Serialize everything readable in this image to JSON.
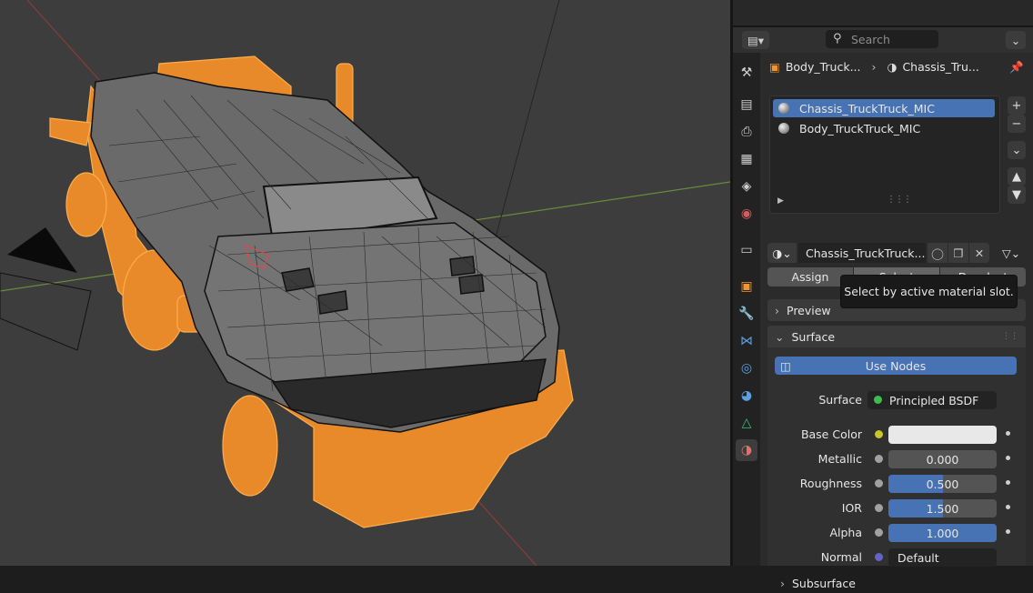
{
  "header": {
    "search_placeholder": "Search"
  },
  "breadcrumb": {
    "object": "Body_Truck...",
    "material": "Chassis_Tru..."
  },
  "material_slots": [
    {
      "label": "Chassis_TruckTruck_MIC",
      "selected": true
    },
    {
      "label": "Body_TruckTruck_MIC",
      "selected": false
    }
  ],
  "material_selector": {
    "name": "Chassis_TruckTruck..."
  },
  "slot_buttons": {
    "assign": "Assign",
    "select": "Select",
    "deselect": "Deselect"
  },
  "panels": {
    "preview": "Preview",
    "surface": "Surface",
    "subsurface": "Subsurface"
  },
  "use_nodes_label": "Use Nodes",
  "surface_row": {
    "label": "Surface",
    "value": "Principled BSDF",
    "color": "#3dbd4d"
  },
  "properties": [
    {
      "label": "Base Color",
      "value": "",
      "fill": 0,
      "socket_color": "#c7c729",
      "is_color": true
    },
    {
      "label": "Metallic",
      "value": "0.000",
      "fill": 0,
      "socket_color": "#a1a1a1"
    },
    {
      "label": "Roughness",
      "value": "0.500",
      "fill": 0.5,
      "socket_color": "#a1a1a1"
    },
    {
      "label": "IOR",
      "value": "1.500",
      "fill": 0.5,
      "socket_color": "#a1a1a1"
    },
    {
      "label": "Alpha",
      "value": "1.000",
      "fill": 1,
      "socket_color": "#a1a1a1"
    },
    {
      "label": "Normal",
      "value": "Default",
      "fill": 0,
      "socket_color": "#6363c7",
      "is_link": true
    }
  ],
  "tooltip": "Select by active material slot.",
  "colors": {
    "accent": "#4772b3",
    "selection_orange": "#ff9a2a",
    "viewport_bg": "#3d3d3d"
  }
}
